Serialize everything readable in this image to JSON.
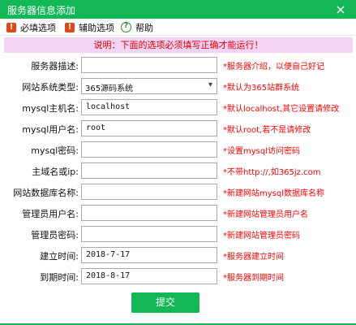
{
  "window": {
    "title": "服务器信息添加",
    "close_glyph": "×"
  },
  "menu": [
    {
      "label": "必填选项",
      "icon": "exclamation-icon"
    },
    {
      "label": "辅助选项",
      "icon": "exclamation-icon"
    },
    {
      "label": "帮助",
      "icon": "help-icon"
    }
  ],
  "notice": "说明：下面的选项必须填写正确才能运行！",
  "fields": [
    {
      "label": "服务器描述:",
      "value": "",
      "hint": "*服务器介绍，以便自己好记"
    },
    {
      "label": "网站系统类型:",
      "value": "365源码系统",
      "hint": "*默认为365站群系统"
    },
    {
      "label": "mysql主机名:",
      "value": "localhost",
      "hint": "*默认localhost,其它设置请修改"
    },
    {
      "label": "mysql用户名:",
      "value": "root",
      "hint": "*默认root,若不是请修改"
    },
    {
      "label": "mysql密码:",
      "value": "",
      "hint": "*设置mysql访问密码"
    },
    {
      "label": "主域名或ip:",
      "value": "",
      "hint": "*不带http://,如365jz.com"
    },
    {
      "label": "网站数据库名称:",
      "value": "",
      "hint": "*新建网站mysql数据库名称"
    },
    {
      "label": "管理员用户名:",
      "value": "",
      "hint": "*新建网站管理员用户名"
    },
    {
      "label": "管理员密码:",
      "value": "",
      "hint": "*新建网站管理员密码"
    },
    {
      "label": "建立时间:",
      "value": "2018-7-17",
      "hint": "*服务器建立时间"
    },
    {
      "label": "到期时间:",
      "value": "2018-8-17",
      "hint": "*服务器到期时间"
    }
  ],
  "submit_label": "提交",
  "colors": {
    "accent": "#12b856",
    "hint": "#ff0000",
    "notice_bg": "#f3d4f4"
  }
}
